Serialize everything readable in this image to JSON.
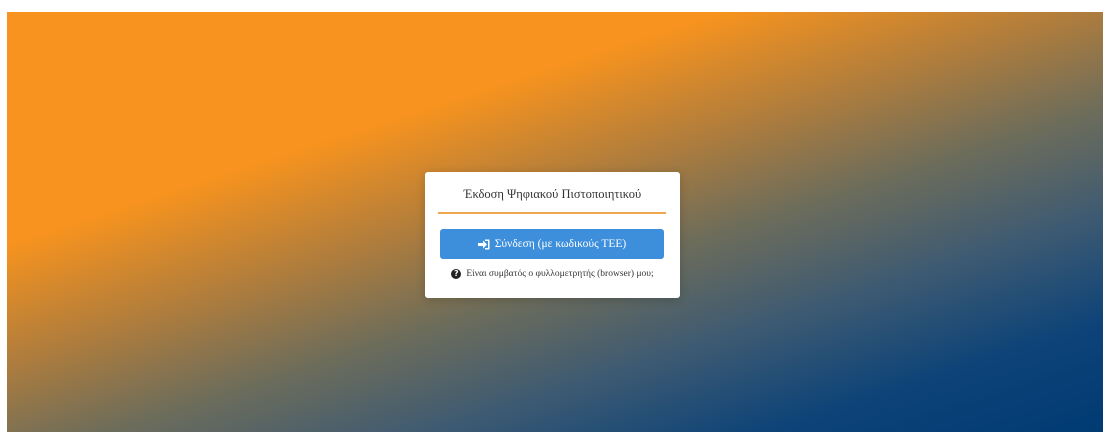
{
  "page": {
    "background_colors": [
      "#f7931e",
      "#003b73"
    ]
  },
  "card": {
    "title": "Έκδοση Ψηφιακού Πιστοποιητικού",
    "divider_color": "#f0a850"
  },
  "login_button": {
    "label": "Σύνδεση (με κωδικούς ΤΕΕ)",
    "icon": "sign-in-icon",
    "color": "#3d8fdc"
  },
  "help_link": {
    "label": "Είναι συμβατός ο φυλλομετρητής (browser) μου;",
    "icon": "question-circle-icon"
  }
}
